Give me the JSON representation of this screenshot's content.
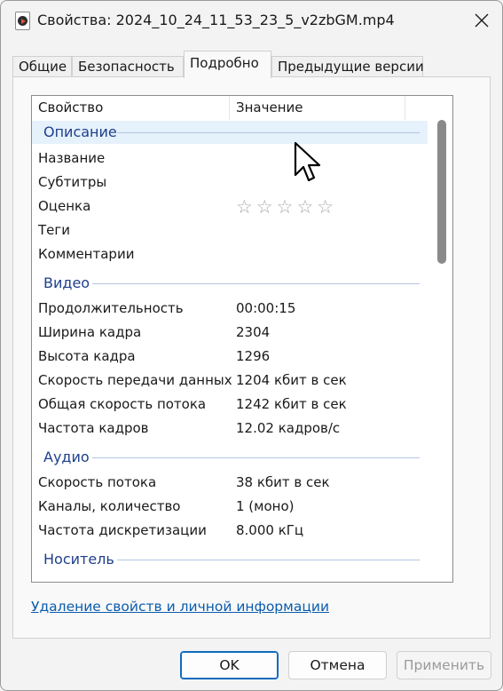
{
  "window": {
    "title": "Свойства: 2024_10_24_11_53_23_5_v2zbGM.mp4"
  },
  "tabs": [
    {
      "label": "Общие"
    },
    {
      "label": "Безопасность"
    },
    {
      "label": "Подробно",
      "active": true
    },
    {
      "label": "Предыдущие версии"
    }
  ],
  "list": {
    "columns": {
      "property": "Свойство",
      "value": "Значение"
    },
    "groups": {
      "description": "Описание",
      "video": "Видео",
      "audio": "Аудио",
      "media": "Носитель"
    },
    "description_rows": [
      {
        "property": "Название",
        "value": ""
      },
      {
        "property": "Субтитры",
        "value": ""
      },
      {
        "property": "Оценка",
        "value": ""
      },
      {
        "property": "Теги",
        "value": ""
      },
      {
        "property": "Комментарии",
        "value": ""
      }
    ],
    "rating": {
      "stars_total": 5,
      "stars_filled": 0,
      "glyphs": "☆☆☆☆☆"
    },
    "video_rows": [
      {
        "property": "Продолжительность",
        "value": "00:00:15"
      },
      {
        "property": "Ширина кадра",
        "value": "2304"
      },
      {
        "property": "Высота кадра",
        "value": "1296"
      },
      {
        "property": "Скорость передачи данных",
        "value": "1204 кбит в сек"
      },
      {
        "property": "Общая скорость потока",
        "value": "1242 кбит в сек"
      },
      {
        "property": "Частота кадров",
        "value": "12.02 кадров/с"
      }
    ],
    "audio_rows": [
      {
        "property": "Скорость потока",
        "value": "38 кбит в сек"
      },
      {
        "property": "Каналы, количество",
        "value": "1 (моно)"
      },
      {
        "property": "Частота дискретизации",
        "value": "8.000 кГц"
      }
    ],
    "scroll_fraction": 0.0
  },
  "link": {
    "label": "Удаление свойств и личной информации"
  },
  "buttons": {
    "ok": "OK",
    "cancel": "Отмена",
    "apply": "Применить"
  },
  "colors": {
    "accent": "#0f6cbd",
    "group_title": "#1e3f8c",
    "link": "#0b5cad",
    "selected_row": "#e5f1fb"
  }
}
